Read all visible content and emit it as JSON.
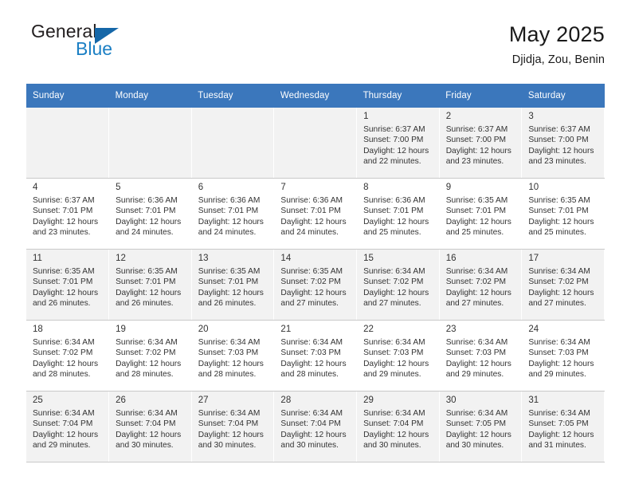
{
  "brand": {
    "name_part1": "General",
    "name_part2": "Blue",
    "logo_icon": "triangle-flag-icon",
    "accent_color": "#1b7fc4"
  },
  "header": {
    "title": "May 2025",
    "subtitle": "Djidja, Zou, Benin"
  },
  "theme": {
    "header_row_color": "#3b77bc",
    "alt_row_color": "#f2f2f2",
    "grid_line_color": "#c9c9c9"
  },
  "calendar": {
    "weekday_headers": [
      "Sunday",
      "Monday",
      "Tuesday",
      "Wednesday",
      "Thursday",
      "Friday",
      "Saturday"
    ],
    "weeks": [
      [
        {
          "day": "",
          "detail": ""
        },
        {
          "day": "",
          "detail": ""
        },
        {
          "day": "",
          "detail": ""
        },
        {
          "day": "",
          "detail": ""
        },
        {
          "day": "1",
          "detail": "Sunrise: 6:37 AM\nSunset: 7:00 PM\nDaylight: 12 hours\nand 22 minutes."
        },
        {
          "day": "2",
          "detail": "Sunrise: 6:37 AM\nSunset: 7:00 PM\nDaylight: 12 hours\nand 23 minutes."
        },
        {
          "day": "3",
          "detail": "Sunrise: 6:37 AM\nSunset: 7:00 PM\nDaylight: 12 hours\nand 23 minutes."
        }
      ],
      [
        {
          "day": "4",
          "detail": "Sunrise: 6:37 AM\nSunset: 7:01 PM\nDaylight: 12 hours\nand 23 minutes."
        },
        {
          "day": "5",
          "detail": "Sunrise: 6:36 AM\nSunset: 7:01 PM\nDaylight: 12 hours\nand 24 minutes."
        },
        {
          "day": "6",
          "detail": "Sunrise: 6:36 AM\nSunset: 7:01 PM\nDaylight: 12 hours\nand 24 minutes."
        },
        {
          "day": "7",
          "detail": "Sunrise: 6:36 AM\nSunset: 7:01 PM\nDaylight: 12 hours\nand 24 minutes."
        },
        {
          "day": "8",
          "detail": "Sunrise: 6:36 AM\nSunset: 7:01 PM\nDaylight: 12 hours\nand 25 minutes."
        },
        {
          "day": "9",
          "detail": "Sunrise: 6:35 AM\nSunset: 7:01 PM\nDaylight: 12 hours\nand 25 minutes."
        },
        {
          "day": "10",
          "detail": "Sunrise: 6:35 AM\nSunset: 7:01 PM\nDaylight: 12 hours\nand 25 minutes."
        }
      ],
      [
        {
          "day": "11",
          "detail": "Sunrise: 6:35 AM\nSunset: 7:01 PM\nDaylight: 12 hours\nand 26 minutes."
        },
        {
          "day": "12",
          "detail": "Sunrise: 6:35 AM\nSunset: 7:01 PM\nDaylight: 12 hours\nand 26 minutes."
        },
        {
          "day": "13",
          "detail": "Sunrise: 6:35 AM\nSunset: 7:01 PM\nDaylight: 12 hours\nand 26 minutes."
        },
        {
          "day": "14",
          "detail": "Sunrise: 6:35 AM\nSunset: 7:02 PM\nDaylight: 12 hours\nand 27 minutes."
        },
        {
          "day": "15",
          "detail": "Sunrise: 6:34 AM\nSunset: 7:02 PM\nDaylight: 12 hours\nand 27 minutes."
        },
        {
          "day": "16",
          "detail": "Sunrise: 6:34 AM\nSunset: 7:02 PM\nDaylight: 12 hours\nand 27 minutes."
        },
        {
          "day": "17",
          "detail": "Sunrise: 6:34 AM\nSunset: 7:02 PM\nDaylight: 12 hours\nand 27 minutes."
        }
      ],
      [
        {
          "day": "18",
          "detail": "Sunrise: 6:34 AM\nSunset: 7:02 PM\nDaylight: 12 hours\nand 28 minutes."
        },
        {
          "day": "19",
          "detail": "Sunrise: 6:34 AM\nSunset: 7:02 PM\nDaylight: 12 hours\nand 28 minutes."
        },
        {
          "day": "20",
          "detail": "Sunrise: 6:34 AM\nSunset: 7:03 PM\nDaylight: 12 hours\nand 28 minutes."
        },
        {
          "day": "21",
          "detail": "Sunrise: 6:34 AM\nSunset: 7:03 PM\nDaylight: 12 hours\nand 28 minutes."
        },
        {
          "day": "22",
          "detail": "Sunrise: 6:34 AM\nSunset: 7:03 PM\nDaylight: 12 hours\nand 29 minutes."
        },
        {
          "day": "23",
          "detail": "Sunrise: 6:34 AM\nSunset: 7:03 PM\nDaylight: 12 hours\nand 29 minutes."
        },
        {
          "day": "24",
          "detail": "Sunrise: 6:34 AM\nSunset: 7:03 PM\nDaylight: 12 hours\nand 29 minutes."
        }
      ],
      [
        {
          "day": "25",
          "detail": "Sunrise: 6:34 AM\nSunset: 7:04 PM\nDaylight: 12 hours\nand 29 minutes."
        },
        {
          "day": "26",
          "detail": "Sunrise: 6:34 AM\nSunset: 7:04 PM\nDaylight: 12 hours\nand 30 minutes."
        },
        {
          "day": "27",
          "detail": "Sunrise: 6:34 AM\nSunset: 7:04 PM\nDaylight: 12 hours\nand 30 minutes."
        },
        {
          "day": "28",
          "detail": "Sunrise: 6:34 AM\nSunset: 7:04 PM\nDaylight: 12 hours\nand 30 minutes."
        },
        {
          "day": "29",
          "detail": "Sunrise: 6:34 AM\nSunset: 7:04 PM\nDaylight: 12 hours\nand 30 minutes."
        },
        {
          "day": "30",
          "detail": "Sunrise: 6:34 AM\nSunset: 7:05 PM\nDaylight: 12 hours\nand 30 minutes."
        },
        {
          "day": "31",
          "detail": "Sunrise: 6:34 AM\nSunset: 7:05 PM\nDaylight: 12 hours\nand 31 minutes."
        }
      ]
    ]
  }
}
